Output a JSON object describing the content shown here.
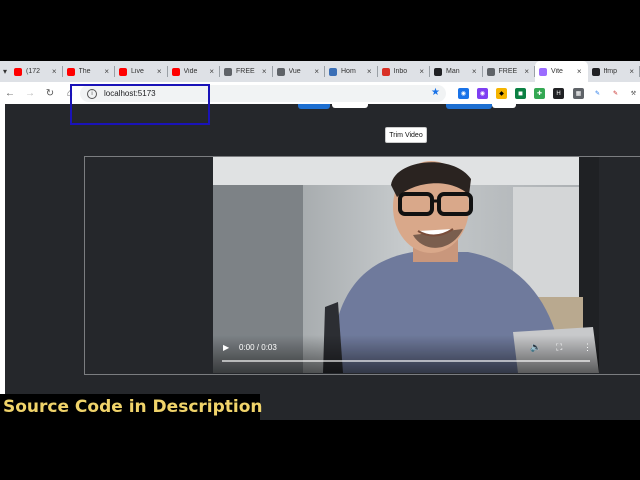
{
  "browser": {
    "tabs": [
      {
        "title": "(172",
        "favicon": "youtube-icon",
        "color": "#ff0000",
        "active": false
      },
      {
        "title": "The",
        "favicon": "youtube-icon",
        "color": "#ff0000",
        "active": false
      },
      {
        "title": "Live",
        "favicon": "youtube-icon",
        "color": "#ff0000",
        "active": false
      },
      {
        "title": "Vide",
        "favicon": "youtube-icon",
        "color": "#ff0000",
        "active": false
      },
      {
        "title": "FREE",
        "favicon": "globe-icon",
        "color": "#5f6368",
        "active": false
      },
      {
        "title": "Vue",
        "favicon": "globe-icon",
        "color": "#5f6368",
        "active": false
      },
      {
        "title": "Hom",
        "favicon": "app-icon",
        "color": "#3b6fb6",
        "active": false
      },
      {
        "title": "Inbo",
        "favicon": "gmail-icon",
        "color": "#d93025",
        "active": false
      },
      {
        "title": "Man",
        "favicon": "app-icon",
        "color": "#202124",
        "active": false
      },
      {
        "title": "FREE",
        "favicon": "globe-icon",
        "color": "#5f6368",
        "active": false
      },
      {
        "title": "Vite",
        "favicon": "vite-icon",
        "color": "#9b6cff",
        "active": true
      },
      {
        "title": "ffmp",
        "favicon": "github-icon",
        "color": "#202124",
        "active": false
      }
    ],
    "url": "localhost:5173"
  },
  "page": {
    "trim_button": "Trim Video"
  },
  "video": {
    "time": "0:00 / 0:03",
    "progress": 0
  },
  "overlay": {
    "caption": "Source Code in  Description"
  },
  "colors": {
    "page_bg": "#25272b",
    "caption_text": "#f0d36a",
    "highlight_box": "#1a13b8"
  }
}
